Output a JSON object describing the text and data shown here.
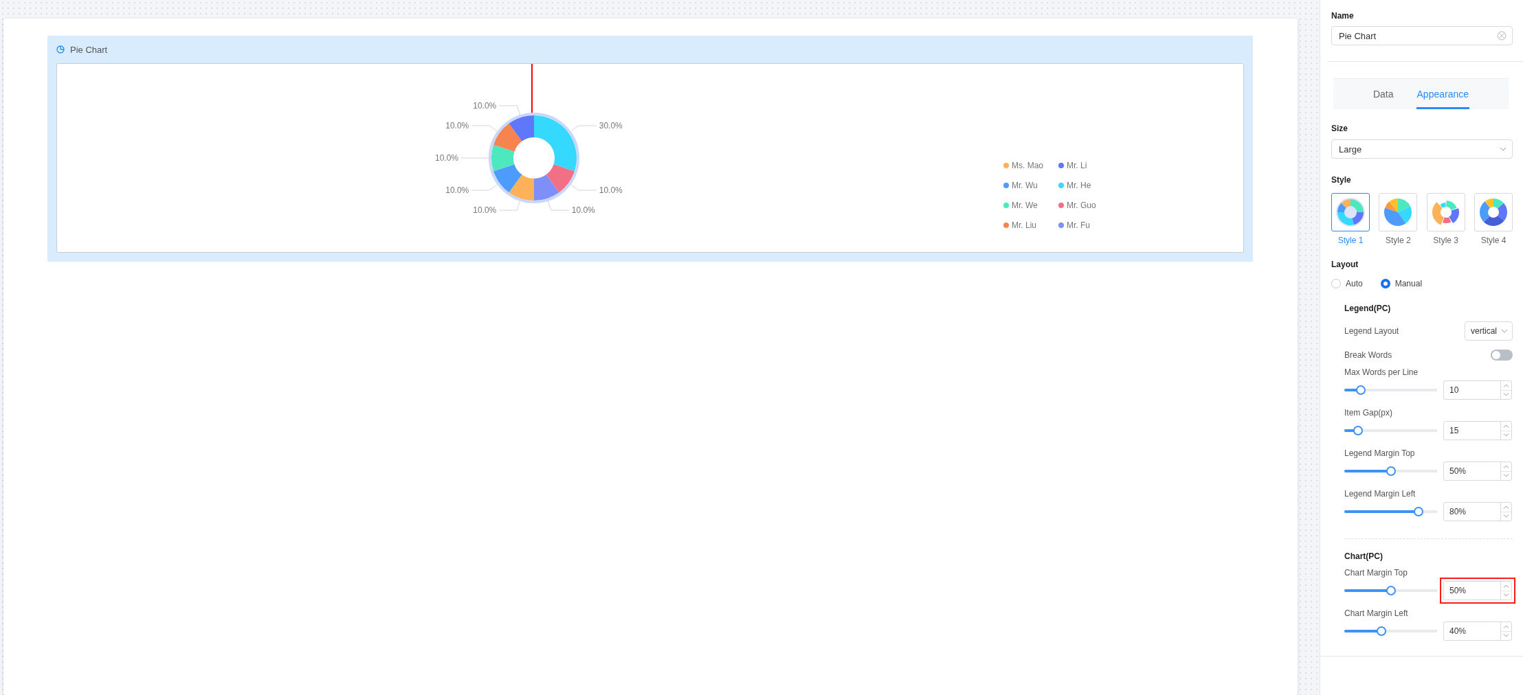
{
  "widget": {
    "title": "Pie Chart",
    "chart_data": {
      "type": "donut",
      "categories": [
        "Ms. Mao",
        "Mr. Wu",
        "Mr. We",
        "Mr. Liu",
        "Mr. Li",
        "Mr. He",
        "Mr. Guo",
        "Mr. Fu"
      ],
      "values": [
        10,
        10,
        10,
        10,
        10,
        30,
        10,
        10
      ],
      "colors": [
        "#fdb25a",
        "#4d9cfb",
        "#4de8bd",
        "#f7844e",
        "#5f77fb",
        "#36d9fe",
        "#f27086",
        "#7e8ff7"
      ],
      "value_labels": [
        "10.0%",
        "10.0%",
        "10.0%",
        "10.0%",
        "10.0%",
        "30.0%",
        "10.0%",
        "10.0%"
      ],
      "legend": true
    }
  },
  "panel": {
    "name_label": "Name",
    "name_value": "Pie Chart",
    "tabs": [
      {
        "label": "Data",
        "selected": false
      },
      {
        "label": "Appearance",
        "selected": true
      }
    ],
    "size_label": "Size",
    "size_value": "Large",
    "style_label": "Style",
    "styles": [
      {
        "label": "Style 1",
        "kind": "glow-ring",
        "selected": true
      },
      {
        "label": "Style 2",
        "kind": "pie",
        "selected": false
      },
      {
        "label": "Style 3",
        "kind": "rose-ring",
        "selected": false
      },
      {
        "label": "Style 4",
        "kind": "ring",
        "selected": false
      }
    ],
    "layout_label": "Layout",
    "layout_options": [
      {
        "label": "Auto",
        "selected": false
      },
      {
        "label": "Manual",
        "selected": true
      }
    ],
    "legend_section": {
      "title": "Legend(PC)",
      "layout_label": "Legend Layout",
      "layout_value": "vertical",
      "break_label": "Break Words",
      "break_on": false,
      "sliders": [
        {
          "label": "Max Words per Line",
          "level": 0.18,
          "value": "10",
          "highlighted": false
        },
        {
          "label": "Item Gap(px)",
          "level": 0.15,
          "value": "15",
          "highlighted": false
        },
        {
          "label": "Legend Margin Top",
          "level": 0.5,
          "value": "50%",
          "highlighted": false
        },
        {
          "label": "Legend Margin Left",
          "level": 0.8,
          "value": "80%",
          "highlighted": false
        }
      ]
    },
    "chart_section": {
      "title": "Chart(PC)",
      "sliders": [
        {
          "label": "Chart Margin Top",
          "level": 0.5,
          "value": "50%",
          "highlighted": true
        },
        {
          "label": "Chart Margin Left",
          "level": 0.4,
          "value": "40%",
          "highlighted": false
        }
      ]
    }
  }
}
